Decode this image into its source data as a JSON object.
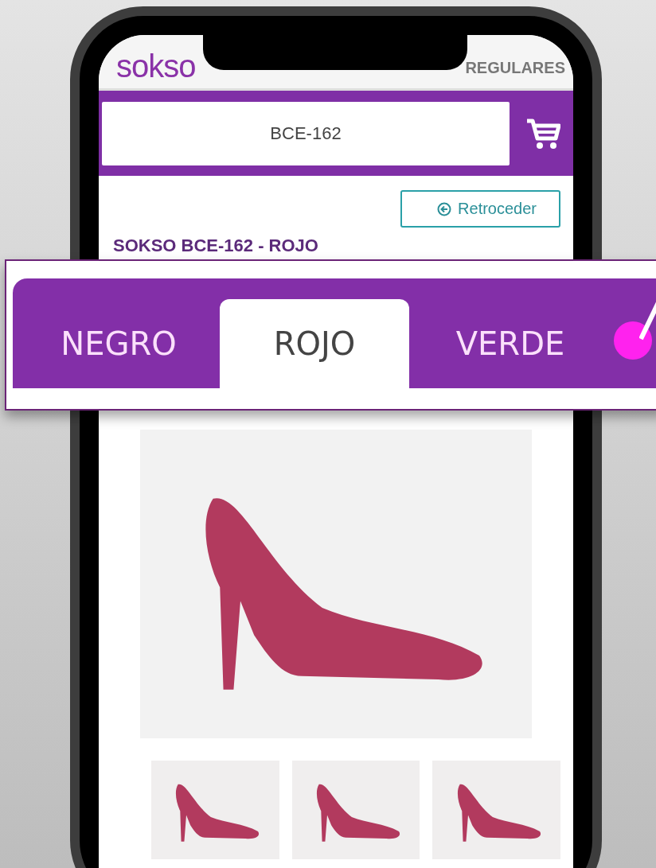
{
  "header": {
    "logo": "sokso",
    "nav_link": "REGULARES"
  },
  "search": {
    "value": "BCE-162"
  },
  "back_button": {
    "label": "Retroceder"
  },
  "product_title": "SOKSO BCE-162 - ROJO",
  "color_tabs": [
    {
      "label": "NEGRO",
      "selected": false
    },
    {
      "label": "ROJO",
      "selected": true
    },
    {
      "label": "VERDE",
      "selected": false
    }
  ]
}
